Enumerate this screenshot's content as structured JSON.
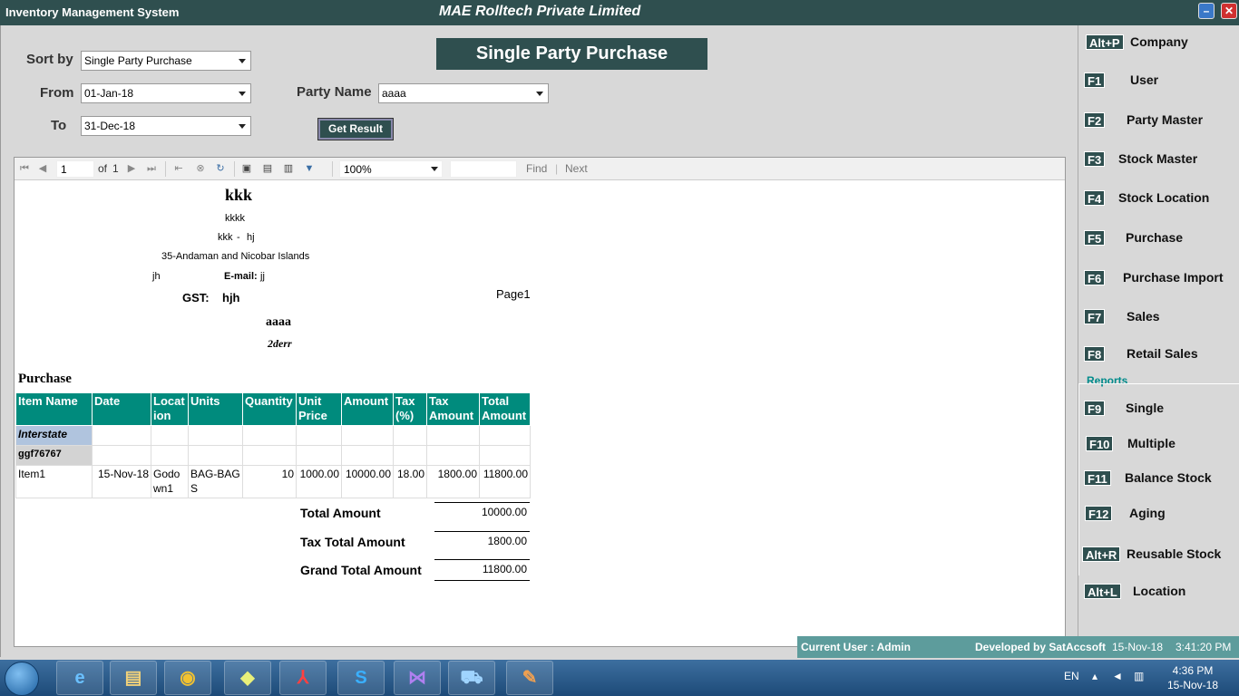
{
  "window": {
    "app_title": "Inventory Management System",
    "company": "MAE Rolltech Private Limited",
    "min_glyph": "–",
    "close_glyph": "✕"
  },
  "filters": {
    "sort_label": "Sort by",
    "sort_value": "Single Party Purchase",
    "from_label": "From",
    "from_value": "01-Jan-18",
    "to_label": "To",
    "to_value": "31-Dec-18",
    "party_label": "Party Name",
    "party_value": "aaaa",
    "get_button": "Get Result"
  },
  "banner": "Single Party Purchase",
  "toolbar": {
    "page": "1",
    "of": "of",
    "total_pages": "1",
    "zoom": "100%",
    "find": "Find",
    "pipe": "|",
    "next": "Next"
  },
  "report": {
    "company_name": "kkk",
    "line1": "kkkk",
    "line2a": "kkk",
    "line2b": "-",
    "line2c": "hj",
    "state": "35-Andaman and Nicobar Islands",
    "phone": "jh",
    "email_label": "E-mail:",
    "email_value": "jj",
    "gst_label": "GST:",
    "gst_value": "hjh",
    "page_label": "Page1",
    "party_name": "aaaa",
    "party_sub": "2derr",
    "section_title": "Purchase",
    "headers": [
      "Item Name",
      "Date",
      "Locat ion",
      "Units",
      "Quantity",
      "Unit Price",
      "Amount",
      "Tax (%)",
      "Tax Amount",
      "Total Amount"
    ],
    "group1": "Interstate",
    "group2": "ggf76767",
    "row": {
      "item": "Item1",
      "date": "15-Nov-18",
      "location": "Godo wn1",
      "units": "BAG-BAGS",
      "quantity": "10",
      "unit_price": "1000.00",
      "amount": "10000.00",
      "tax_pct": "18.00",
      "tax_amount": "1800.00",
      "total_amount": "11800.00"
    },
    "total_label": "Total Amount",
    "total_value": "10000.00",
    "tax_total_label": "Tax Total Amount",
    "tax_total_value": "1800.00",
    "grand_label": "Grand Total Amount",
    "grand_value": "11800.00"
  },
  "menu": [
    {
      "key": "Alt+P",
      "label": "Company"
    },
    {
      "key": "F1",
      "label": "User"
    },
    {
      "key": "F2",
      "label": "Party Master"
    },
    {
      "key": "F3",
      "label": "Stock Master"
    },
    {
      "key": "F4",
      "label": "Stock Location"
    },
    {
      "key": "F5",
      "label": "Purchase"
    },
    {
      "key": "F6",
      "label": "Purchase Import"
    },
    {
      "key": "F7",
      "label": "Sales"
    },
    {
      "key": "F8",
      "label": "Retail Sales"
    }
  ],
  "reports_label": "Reports",
  "reports": [
    {
      "key": "F9",
      "label": "Single"
    },
    {
      "key": "F10",
      "label": "Multiple"
    },
    {
      "key": "F11",
      "label": "Balance Stock"
    },
    {
      "key": "F12",
      "label": "Aging"
    },
    {
      "key": "Alt+R",
      "label": "Reusable Stock"
    },
    {
      "key": "Alt+L",
      "label": "Location"
    }
  ],
  "status": {
    "user": "Current User : Admin",
    "developer": "Developed by SatAccsoft",
    "date": "15-Nov-18",
    "time": "3:41:20 PM"
  },
  "taskbar": {
    "lang": "EN",
    "clock_time": "4:36 PM",
    "clock_date": "15-Nov-18",
    "apps": [
      "internet-explorer-icon",
      "file-explorer-icon",
      "chrome-icon",
      "sticky-notes-icon",
      "pdf-reader-icon",
      "skype-icon",
      "visual-studio-icon",
      "cart-app-icon",
      "paint-icon"
    ]
  }
}
